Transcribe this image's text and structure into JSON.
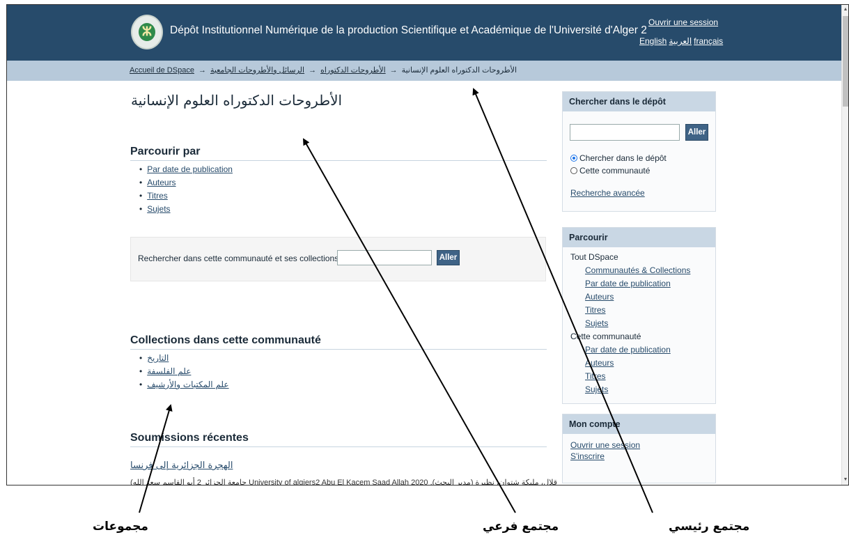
{
  "header": {
    "site_title": "Dépôt Institutionnel Numérique de la production Scientifique et Académique de l'Université d'Alger 2",
    "login": "Ouvrir une session",
    "languages": [
      "English",
      "العربية",
      "français"
    ]
  },
  "breadcrumb": {
    "items": [
      "Accueil de DSpace",
      "الرسائل والأطروحات الجامعية",
      "الأطروحات الدكتوراه",
      "الأطروحات الدكتوراه العلوم الإنسانية"
    ],
    "separator": "→"
  },
  "main": {
    "title": "الأطروحات الدكتوراه العلوم الإنسانية",
    "browse_title": "Parcourir par",
    "browse_links": [
      "Par date de publication",
      "Auteurs",
      "Titres",
      "Sujets"
    ],
    "search_label": "Rechercher dans cette communauté et ses collections :",
    "search_button": "Aller",
    "collections_title": "Collections dans cette communauté",
    "collections": [
      "التاريخ",
      "علم الفلسفة",
      "علم المكتبات والأرشيف"
    ],
    "recent_title": "Soumissions récentes",
    "recent_item_title": "الهجرة الجزائرية إلى فرنسا",
    "recent_item_meta": "(جامعة الجزائر 2 أبو القاسم سعد الله University of algiers2 Abu El Kacem Saad Allah 2020 ,قلال، مليكة شتوان، نظيرة (مدير البحث)"
  },
  "sidebar": {
    "search": {
      "title": "Chercher dans le dépôt",
      "button": "Aller",
      "options": [
        "Chercher dans le dépôt",
        "Cette communauté"
      ],
      "selected_option": "Chercher dans le dépôt",
      "advanced": "Recherche avancée"
    },
    "browse": {
      "title": "Parcourir",
      "group1": "Tout DSpace",
      "group1_links": [
        "Communautés & Collections",
        "Par date de publication",
        "Auteurs",
        "Titres",
        "Sujets"
      ],
      "group2": "Cette communauté",
      "group2_links": [
        "Par date de publication",
        "Auteurs",
        "Titres",
        "Sujets"
      ]
    },
    "account": {
      "title": "Mon compte",
      "links": [
        "Ouvrir une session",
        "S'inscrire"
      ]
    }
  },
  "annotations": {
    "labels": [
      "مجموعات",
      "مجتمع فرعي",
      "مجتمع رئيسي"
    ]
  },
  "colors": {
    "header_bg": "#274b6b",
    "trail_bg": "#b7c9da",
    "button_bg": "#3f6386",
    "panel_head_bg": "#c9d7e4"
  }
}
